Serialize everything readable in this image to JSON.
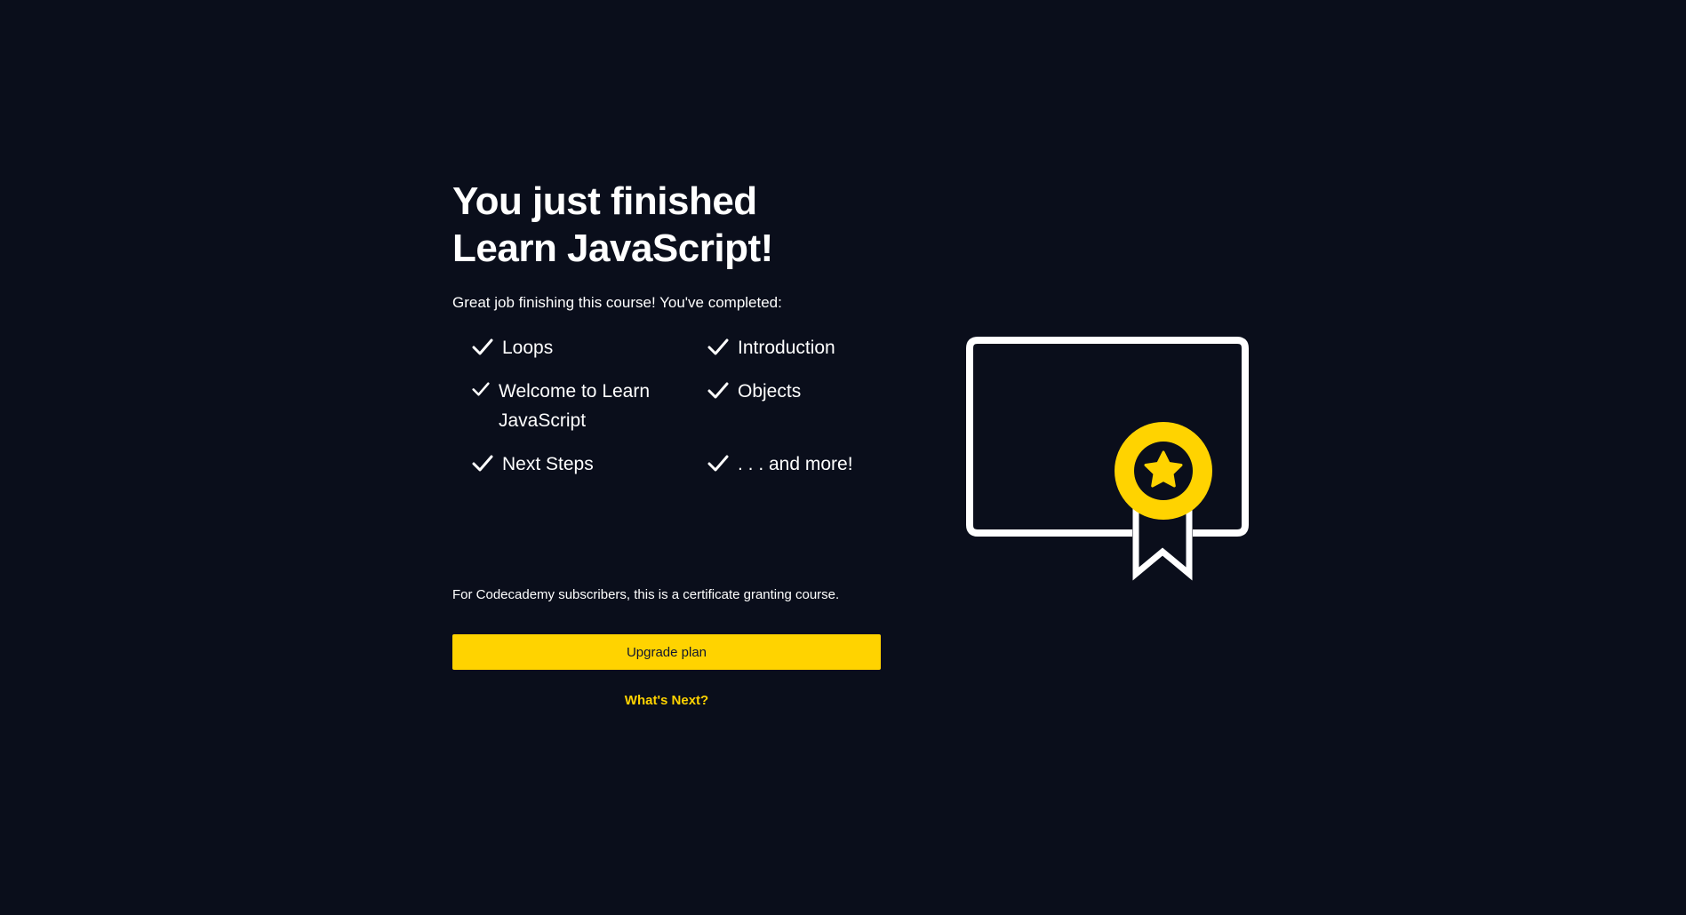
{
  "colors": {
    "background": "#0a0e1b",
    "accent": "#ffd300",
    "text": "#ffffff",
    "button_text": "#10162f"
  },
  "title_line_1": "You just finished",
  "title_line_2": "Learn JavaScript!",
  "subtitle": "Great job finishing this course! You've completed:",
  "completed_icon": "check-icon",
  "completed_modules": [
    "Loops",
    "Introduction",
    "Welcome to Learn JavaScript",
    "Objects",
    "Next Steps",
    ". . . and more!"
  ],
  "subscriber_notice": "For Codecademy subscribers, this is a certificate granting course.",
  "upgrade_button": "Upgrade plan",
  "whats_next_link": "What's Next?",
  "illustration_icon": "certificate-icon"
}
